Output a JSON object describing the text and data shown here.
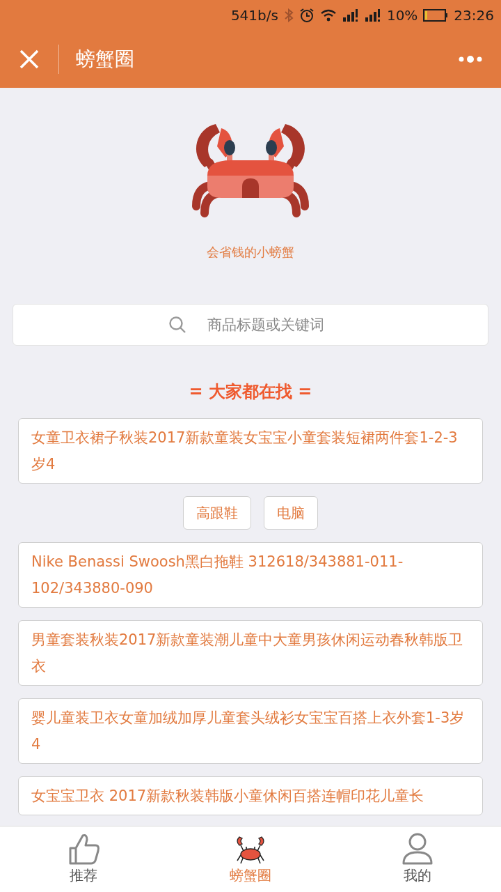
{
  "status_bar": {
    "speed": "541b/s",
    "battery": "10%",
    "time": "23:26"
  },
  "header": {
    "title": "螃蟹圈"
  },
  "profile": {
    "tagline": "会省钱的小螃蟹"
  },
  "search": {
    "placeholder": "商品标题或关键词"
  },
  "section_title": "= 大家都在找 =",
  "items": [
    {
      "kind": "card",
      "text": "女童卫衣裙子秋装2017新款童装女宝宝小童套装短裙两件套1-2-3岁4"
    },
    {
      "kind": "chips",
      "chips": [
        "高跟鞋",
        "电脑"
      ]
    },
    {
      "kind": "card",
      "text": "Nike Benassi Swoosh黑白拖鞋 312618/343881-011-102/343880-090"
    },
    {
      "kind": "card",
      "text": "男童套装秋装2017新款童装潮儿童中大童男孩休闲运动春秋韩版卫衣"
    },
    {
      "kind": "card",
      "text": "婴儿童装卫衣女童加绒加厚儿童套头绒衫女宝宝百搭上衣外套1-3岁4"
    },
    {
      "kind": "card",
      "text": "女宝宝卫衣 2017新款秋装韩版小童休闲百搭连帽印花儿童长"
    }
  ],
  "tabs": [
    {
      "kind": "thumb",
      "label": "推荐",
      "selected": false
    },
    {
      "kind": "crab",
      "label": "螃蟹圈",
      "selected": true
    },
    {
      "kind": "person",
      "label": "我的",
      "selected": false
    }
  ]
}
